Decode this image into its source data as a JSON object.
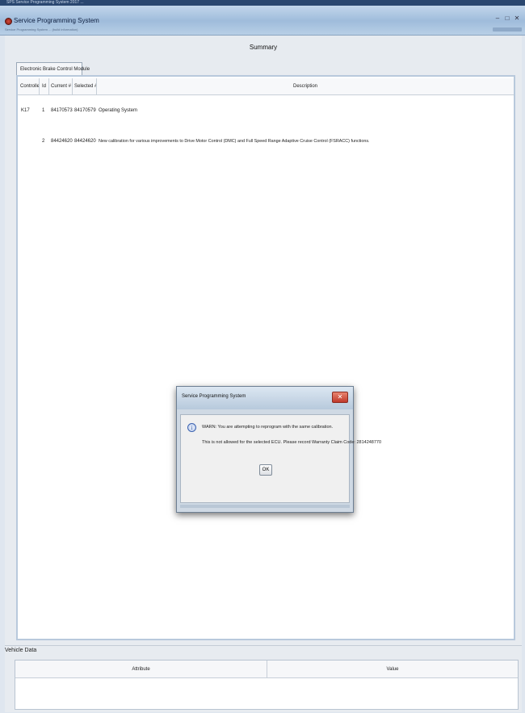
{
  "window": {
    "top_strip_text": "SPS Service Programming System 2017 ...",
    "app_title": "Service Programming System",
    "subtitle": "Service Programming System ... (build information)",
    "controls": [
      "–",
      "□",
      "✕"
    ]
  },
  "summary": {
    "title": "Summary",
    "tab_label": "Electronic Brake Control Module",
    "columns": [
      "Controller",
      "Id",
      "Current #",
      "Selected #",
      "Description"
    ],
    "rows": [
      {
        "controller": "K17",
        "id": "1",
        "current": "84170573",
        "selected": "84170579",
        "description": "Operating System"
      },
      {
        "controller": "",
        "id": "2",
        "current": "84424620",
        "selected": "84424620",
        "description": "New calibration for various improvements to Drive Motor Control (DMC) and Full Speed Range Adaptive Cruise Control (FSRACC) functions."
      }
    ]
  },
  "vehicle_data": {
    "label": "Vehicle Data",
    "columns": [
      "Attribute",
      "Value"
    ]
  },
  "dialog": {
    "title": "Service Programming System",
    "close_icon": "close-icon",
    "info_icon": "info-icon",
    "message_line1": "WARN: You are attempting to reprogram with the same calibration.",
    "message_line2": "This is not allowed for the selected ECU. Please record Warranty Claim Code: 2814248770",
    "ok_label": "OK"
  },
  "colors": {
    "title_bar": "#9fbcdb",
    "panel_border": "#b8c9dc",
    "close_button": "#c0392b"
  }
}
